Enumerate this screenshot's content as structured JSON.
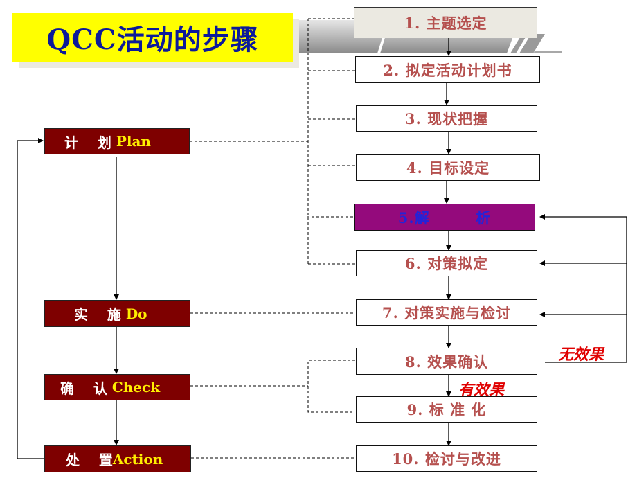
{
  "title": "QCC活动的步骤",
  "steps": [
    {
      "label": "1. 主题选定"
    },
    {
      "label": "2. 拟定活动计划书"
    },
    {
      "label": "3. 现状把握"
    },
    {
      "label": "4. 目标设定"
    },
    {
      "label": "5.解        析"
    },
    {
      "label": "6. 对策拟定"
    },
    {
      "label": "7. 对策实施与检讨"
    },
    {
      "label": "8. 效果确认"
    },
    {
      "label": "9. 标 准 化"
    },
    {
      "label": "10. 检讨与改进"
    }
  ],
  "phases": [
    {
      "cn": "计    划 ",
      "en": "Plan"
    },
    {
      "cn": "实    施 ",
      "en": "Do"
    },
    {
      "cn": "确    认 ",
      "en": "Check"
    },
    {
      "cn": "处    置",
      "en": "Action"
    }
  ],
  "annotations": {
    "no_effect": "无效果",
    "effective": "有效果"
  },
  "colors": {
    "title_bg": "#ffff00",
    "title_text": "#0c1a9a",
    "phase_bg": "#7e0000",
    "phase_en": "#ffee00",
    "step_text": "#b5504e",
    "highlight_step_bg": "#940a7c",
    "highlight_step_text": "#2323d8",
    "annotation": "#e00000"
  }
}
